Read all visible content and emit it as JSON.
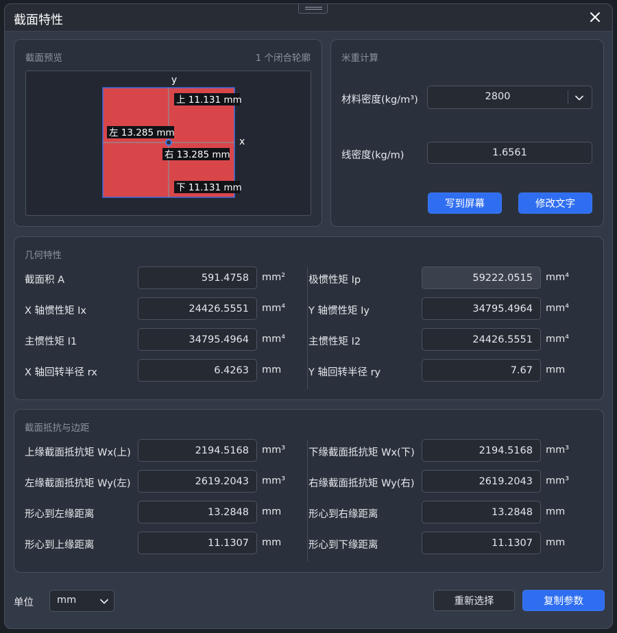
{
  "dialog": {
    "title": "截面特性"
  },
  "preview": {
    "title": "截面预览",
    "contour_count": "1 个闭合轮廓",
    "axis_y": "y",
    "axis_x": "x",
    "top_label": "上 11.131 mm",
    "left_label": "左 13.285 mm",
    "right_label": "右 13.285 mm",
    "bottom_label": "下 11.131 mm"
  },
  "weight_calc": {
    "title": "米重计算",
    "density_label": "材料密度(kg/m³)",
    "density_value": "2800",
    "linear_density_label": "线密度(kg/m)",
    "linear_density_value": "1.6561",
    "write_screen_button": "写到屏幕",
    "modify_text_button": "修改文字"
  },
  "geometry": {
    "title": "几何特性",
    "area_label": "截面积 A",
    "area_value": "591.4758",
    "area_unit": "mm²",
    "ip_label": "极惯性矩 Ip",
    "ip_value": "59222.0515",
    "ip_unit": "mm⁴",
    "ix_label": "X 轴惯性矩 Ix",
    "ix_value": "24426.5551",
    "ix_unit": "mm⁴",
    "iy_label": "Y 轴惯性矩 Iy",
    "iy_value": "34795.4964",
    "iy_unit": "mm⁴",
    "i1_label": "主惯性矩 I1",
    "i1_value": "34795.4964",
    "i1_unit": "mm⁴",
    "i2_label": "主惯性矩 I2",
    "i2_value": "24426.5551",
    "i2_unit": "mm⁴",
    "rx_label": "X 轴回转半径 rx",
    "rx_value": "6.4263",
    "rx_unit": "mm",
    "ry_label": "Y 轴回转半径 ry",
    "ry_value": "7.67",
    "ry_unit": "mm"
  },
  "resistance": {
    "title": "截面抵抗与边距",
    "wx_top_label": "上缘截面抵抗矩 Wx(上)",
    "wx_top_value": "2194.5168",
    "wx_top_unit": "mm³",
    "wx_bottom_label": "下缘截面抵抗矩 Wx(下)",
    "wx_bottom_value": "2194.5168",
    "wx_bottom_unit": "mm³",
    "wy_left_label": "左缘截面抵抗矩 Wy(左)",
    "wy_left_value": "2619.2043",
    "wy_left_unit": "mm³",
    "wy_right_label": "右缘截面抵抗矩 Wy(右)",
    "wy_right_value": "2619.2043",
    "wy_right_unit": "mm³",
    "dist_left_label": "形心到左缘距离",
    "dist_left_value": "13.2848",
    "dist_left_unit": "mm",
    "dist_right_label": "形心到右缘距离",
    "dist_right_value": "13.2848",
    "dist_right_unit": "mm",
    "dist_top_label": "形心到上缘距离",
    "dist_top_value": "11.1307",
    "dist_top_unit": "mm",
    "dist_bottom_label": "形心到下缘距离",
    "dist_bottom_value": "11.1307",
    "dist_bottom_unit": "mm"
  },
  "footer": {
    "unit_label": "单位",
    "unit_value": "mm",
    "reselect_button": "重新选择",
    "copy_button": "复制参数"
  },
  "colors": {
    "accent": "#2f6ef0",
    "section_fill": "#d9464a",
    "section_outline": "#3f6fe0"
  },
  "icons": {
    "close": "close-icon",
    "dropdown": "chevron-down-icon",
    "drag": "drag-handle-icon"
  }
}
